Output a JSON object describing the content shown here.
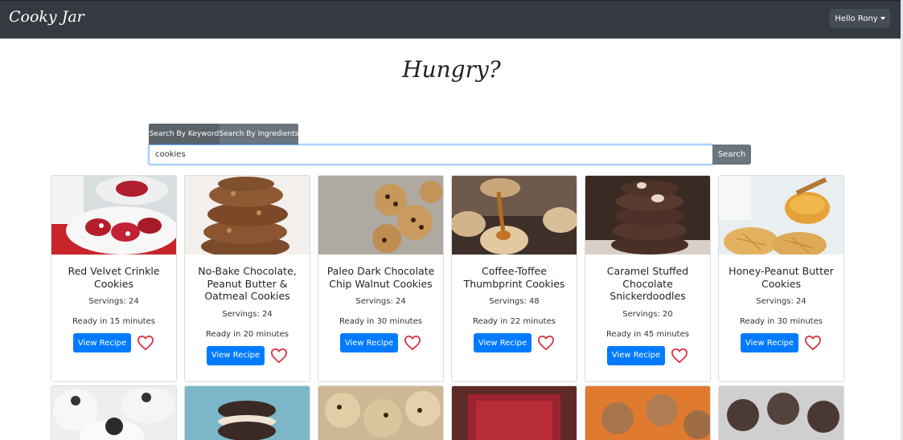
{
  "app": {
    "brand": "Cooky Jar",
    "user_menu": "Hello Rony"
  },
  "hero": {
    "title": "Hungry?"
  },
  "search": {
    "tabs": [
      "Search By Keyword",
      "Search By Ingredients"
    ],
    "active_tab": "Search By Keyword",
    "value": "cookies",
    "button": "Search"
  },
  "recipes": [
    {
      "title": "Red Velvet Crinkle Cookies",
      "servings": "Servings: 24",
      "ready": "Ready in 15 minutes",
      "button": "View Recipe",
      "favorite": false
    },
    {
      "title": "No-Bake Chocolate, Peanut Butter & Oatmeal Cookies",
      "servings": "Servings: 24",
      "ready": "Ready in 20 minutes",
      "button": "View Recipe",
      "favorite": false
    },
    {
      "title": "Paleo Dark Chocolate Chip Walnut Cookies",
      "servings": "Servings: 24",
      "ready": "Ready in 30 minutes",
      "button": "View Recipe",
      "favorite": false
    },
    {
      "title": "Coffee-Toffee Thumbprint Cookies",
      "servings": "Servings: 48",
      "ready": "Ready in 22 minutes",
      "button": "View Recipe",
      "favorite": false
    },
    {
      "title": "Caramel Stuffed Chocolate Snickerdoodles",
      "servings": "Servings: 20",
      "ready": "Ready in 45 minutes",
      "button": "View Recipe",
      "favorite": false
    },
    {
      "title": "Honey-Peanut Butter Cookies",
      "servings": "Servings: 24",
      "ready": "Ready in 30 minutes",
      "button": "View Recipe",
      "favorite": false
    }
  ],
  "colors": {
    "navbar": "#343a40",
    "primary": "#007bff",
    "secondary": "#6c757d",
    "heart": "#dc3545"
  }
}
